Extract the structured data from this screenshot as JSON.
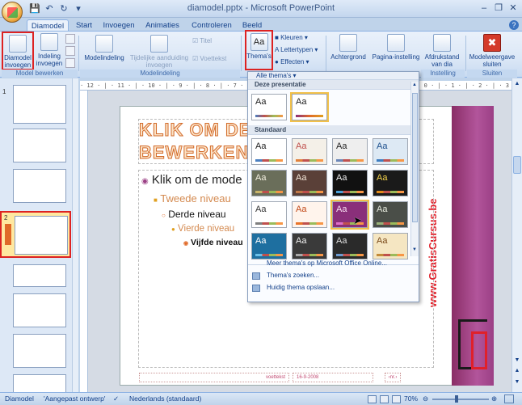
{
  "window": {
    "title": "diamodel.pptx - Microsoft PowerPoint"
  },
  "tabs": [
    "Diamodel",
    "Start",
    "Invoegen",
    "Animaties",
    "Controleren",
    "Beeld"
  ],
  "ribbon": {
    "groups": {
      "edit": {
        "label": "Model bewerken",
        "buttons": [
          "Diamodel invoegen",
          "Indeling invoegen"
        ]
      },
      "layout": {
        "label": "Modelindeling",
        "buttons": [
          "Modelindeling",
          "Tijdelijke aanduiding invoegen"
        ],
        "checks": [
          "Titel",
          "Voettekst"
        ]
      },
      "theme": {
        "buttons": [
          "Thema's"
        ],
        "small": [
          "Kleuren",
          "Lettertypen",
          "Effecten"
        ]
      },
      "background": {
        "buttons": [
          "Achtergrond"
        ]
      },
      "pagesetup": {
        "label": "Instelling",
        "buttons": [
          "Pagina-instelling",
          "Afdrukstand van dia"
        ]
      },
      "close": {
        "label": "Sluiten",
        "buttons": [
          "Modelweergave sluiten"
        ]
      }
    }
  },
  "gallery": {
    "header": "Alle thema's",
    "section_current": "Deze presentatie",
    "section_standard": "Standaard",
    "sample": "Aa",
    "menu": [
      "Meer thema's op Microsoft Office Online...",
      "Thema's zoeken...",
      "Huidig thema opslaan..."
    ],
    "themes": [
      {
        "bg": "#ffffff",
        "fg": "#222",
        "sw": "#4a7fc1"
      },
      {
        "bg": "#f4f0e8",
        "fg": "#c0504d",
        "sw": "#e0803a"
      },
      {
        "bg": "#eeeeee",
        "fg": "#222",
        "sw": "#6a86b8"
      },
      {
        "bg": "#dde9f4",
        "fg": "#1c4f8c",
        "sw": "#3c7cc0"
      },
      {
        "bg": "#6a6e5a",
        "fg": "#f3efe0",
        "sw": "#c9b56a"
      },
      {
        "bg": "#5a4038",
        "fg": "#f2e6d8",
        "sw": "#c07848"
      },
      {
        "bg": "#111111",
        "fg": "#eeeeee",
        "sw": "#49a0d8"
      },
      {
        "bg": "#1a1a1a",
        "fg": "#f3d24a",
        "sw": "#e08a1a"
      },
      {
        "bg": "#ffffff",
        "fg": "#333",
        "sw": "#7f7f7f"
      },
      {
        "bg": "#fff4ec",
        "fg": "#c24a1a",
        "sw": "#e8742a"
      },
      {
        "bg": "#8a2f7a",
        "fg": "#f8e0f2",
        "sw": "#e070c8"
      },
      {
        "bg": "#4a4e48",
        "fg": "#e8ece0",
        "sw": "#9ab27a"
      },
      {
        "bg": "#1e6fa0",
        "fg": "#ffffff",
        "sw": "#6cc0e8"
      },
      {
        "bg": "#3a3a3a",
        "fg": "#eeeeee",
        "sw": "#a8a8a8"
      },
      {
        "bg": "#2a2a2a",
        "fg": "#dddddd",
        "sw": "#6c9ad0"
      },
      {
        "bg": "#f5e6c2",
        "fg": "#7a4a1a",
        "sw": "#c28a3a"
      }
    ]
  },
  "slide": {
    "title_line1": "KLIK OM DE",
    "title_line2": "BEWERKEN",
    "levels": [
      "Klik om de mode",
      "Tweede niveau",
      "Derde niveau",
      "Vierde niveau",
      "Vijfde niveau"
    ],
    "footer": [
      "voettekst",
      "16-9-2008",
      "‹nr.›"
    ],
    "watermark": "www.GratisCursus.be"
  },
  "thumbs": {
    "numbers": [
      "1",
      "2"
    ]
  },
  "ruler": "· 12 · | · 11 · | · 10 · | · 9 · | · 8 · | · 7 · | · 6 · | · 5 · | · 4 · | · 3 · | · 2 · | · 1 · | · 0 · | · 1 · | · 2 · | · 3 · | · 4 · | · 5 · | · 6 · | · 7 · | · 8 · | · 9 · | · 10 · | · 11 · | · 12",
  "status": {
    "view": "Diamodel",
    "theme": "'Aangepast ontwerp'",
    "language": "Nederlands (standaard)",
    "zoom": "70%"
  },
  "colors": {
    "highlight": "#d22222",
    "accent_title": "#d26a2a",
    "purple_panel": "#9b3f85"
  }
}
